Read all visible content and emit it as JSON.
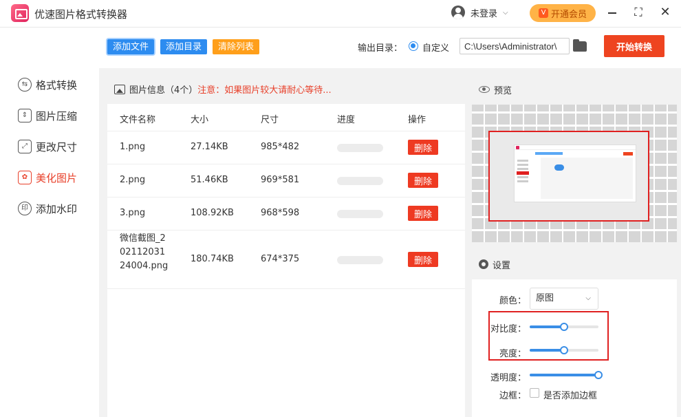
{
  "app": {
    "title": "优速图片格式转换器"
  },
  "header": {
    "user_label": "未登录",
    "vip_label": "开通会员"
  },
  "sidebar": {
    "items": [
      {
        "label": "格式转换",
        "icon": "swap-icon"
      },
      {
        "label": "图片压缩",
        "icon": "compress-icon"
      },
      {
        "label": "更改尺寸",
        "icon": "resize-icon"
      },
      {
        "label": "美化图片",
        "icon": "beautify-icon",
        "active": true
      },
      {
        "label": "添加水印",
        "icon": "watermark-icon"
      }
    ]
  },
  "toolbar": {
    "add_file": "添加文件",
    "add_dir": "添加目录",
    "clear_list": "清除列表",
    "output_label": "输出目录：",
    "custom_label": "自定义",
    "output_path": "C:\\Users\\Administrator\\",
    "start": "开始转换"
  },
  "file_panel": {
    "title": "图片信息",
    "count": "（4个）",
    "note": "注意：如果图片较大请耐心等待...",
    "columns": [
      "文件名称",
      "大小",
      "尺寸",
      "进度",
      "操作"
    ],
    "rows": [
      {
        "name": "1.png",
        "size": "27.14KB",
        "dims": "985*482",
        "progress": 0,
        "action": "删除"
      },
      {
        "name": "2.png",
        "size": "51.46KB",
        "dims": "969*581",
        "progress": 0,
        "action": "删除"
      },
      {
        "name": "3.png",
        "size": "108.92KB",
        "dims": "968*598",
        "progress": 0,
        "action": "删除"
      },
      {
        "name": "微信截图_20211203124004.png",
        "size": "180.74KB",
        "dims": "674*375",
        "progress": 0,
        "action": "删除"
      }
    ]
  },
  "preview": {
    "title": "预览"
  },
  "settings": {
    "title": "设置",
    "color_label": "颜色：",
    "color_value": "原图",
    "contrast_label": "对比度：",
    "contrast_value": 0.5,
    "brightness_label": "亮度：",
    "brightness_value": 0.5,
    "opacity_label": "透明度：",
    "opacity_value": 1.0,
    "border_label": "边框：",
    "border_checkbox_label": "是否添加边框"
  },
  "colors": {
    "primary": "#2d8cf0",
    "danger": "#ee3a22",
    "accent_orange": "#ff9f1a",
    "highlight": "#e02020"
  }
}
